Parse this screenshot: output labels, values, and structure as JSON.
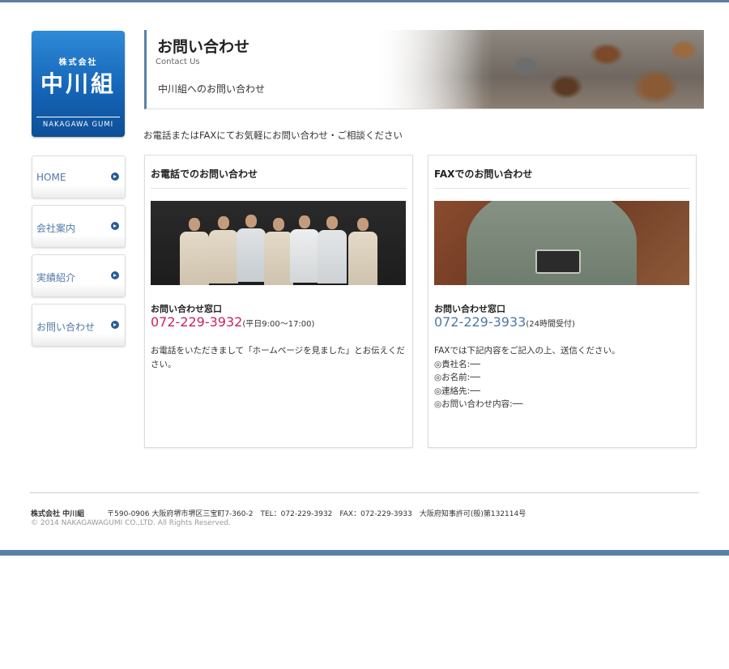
{
  "logo": {
    "small": "株式会社",
    "name": "中川組",
    "english": "NAKAGAWA GUMI"
  },
  "header": {
    "title": "お問い合わせ",
    "subtitle": "Contact Us",
    "description": "中川組へのお問い合わせ"
  },
  "nav": {
    "items": [
      {
        "label": "HOME"
      },
      {
        "label": "会社案内"
      },
      {
        "label": "実績紹介"
      },
      {
        "label": "お問い合わせ"
      }
    ]
  },
  "intro": "お電話またはFAXにてお気軽にお問い合わせ・ご相談ください",
  "phone_box": {
    "title": "お電話でのお問い合わせ",
    "window_label": "お問い合わせ窓口",
    "number": "072-229-3932",
    "hours": "(平日9:00〜17:00)",
    "note": "お電話をいただきまして「ホームページを見ました」とお伝えください。",
    "number_color": "#c8245a"
  },
  "fax_box": {
    "title": "FAXでのお問い合わせ",
    "window_label": "お問い合わせ窓口",
    "number": "072-229-3933",
    "hours": "(24時間受付)",
    "note_lines": [
      "FAXでは下記内容をご記入の上、送信ください。",
      "◎貴社名:──",
      "◎お名前:──",
      "◎連絡先:──",
      "◎お問い合わせ内容:──"
    ],
    "number_color": "#4f78a6"
  },
  "footer": {
    "company": "株式会社 中川組",
    "address": "〒590-0906 大阪府堺市堺区三宝町7-360-2　TEL：072-229-3932　FAX：072-229-3933　大阪府知事許可(般)第132114号",
    "copyright": "© 2014 NAKAGAWAGUMI CO.,LTD. All Rights Reserved."
  },
  "colors": {
    "accent": "#5b7fa6",
    "logo_blue": "#1565b8",
    "nav_text": "#4f78a6"
  }
}
